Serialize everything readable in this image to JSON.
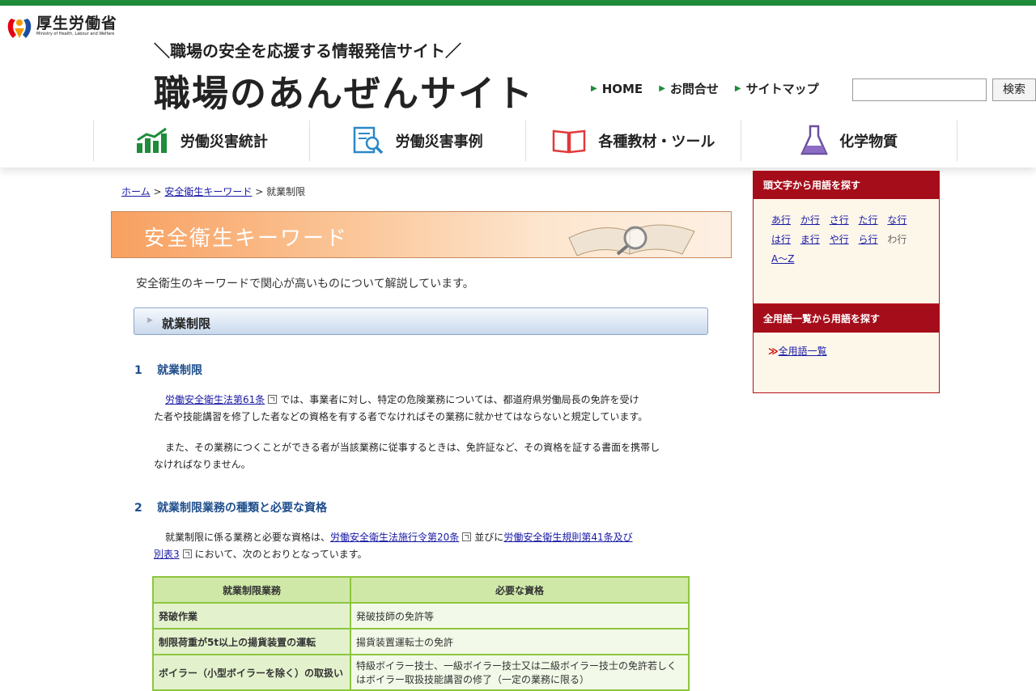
{
  "ministry": {
    "name": "厚生労働省",
    "english": "Ministry of Health, Labour and Welfare"
  },
  "site": {
    "tagline": "＼職場の安全を応援する情報発信サイト／",
    "title": "職場のあんぜんサイト"
  },
  "util_nav": [
    "HOME",
    "お問合せ",
    "サイトマップ"
  ],
  "search": {
    "button": "検索",
    "value": ""
  },
  "global_nav": [
    {
      "label": "労働災害統計",
      "icon": "bar-chart-icon"
    },
    {
      "label": "労働災害事例",
      "icon": "document-search-icon"
    },
    {
      "label": "各種教材・ツール",
      "icon": "book-icon"
    },
    {
      "label": "化学物質",
      "icon": "flask-icon"
    }
  ],
  "breadcrumb": {
    "home": "ホーム",
    "sep1": ">",
    "category": "安全衛生キーワード",
    "sep2": ">",
    "current": "就業制限"
  },
  "banner": {
    "title": "安全衛生キーワード"
  },
  "lead": "安全衛生のキーワードで関心が高いものについて解説しています。",
  "section_heading": "就業制限",
  "sections": [
    {
      "num": "1",
      "title": "就業制限",
      "p1_link": "労働安全衛生法第61条",
      "p1_text_a": "では、事業者に対し、特定の危険業務については、都道府県労働局長の免許を受け",
      "p1_text_b": "た者や技能講習を修了した者などの資格を有する者でなければその業務に就かせてはならないと規定しています。",
      "p2_a": "また、その業務につくことができる者が当該業務に従事するときは、免許証など、その資格を証する書面を携帯し",
      "p2_b": "なければなりません。"
    },
    {
      "num": "2",
      "title": "就業制限業務の種類と必要な資格",
      "p_text_a": "就業制限に係る業務と必要な資格は、",
      "p_link1": "労働安全衛生法施行令第20条",
      "p_text_b": "並びに",
      "p_link2a": "労働安全衛生規則第41条及び",
      "p_link2b": "別表3",
      "p_text_c": "において、次のとおりとなっています。"
    }
  ],
  "table": {
    "headers": [
      "就業制限業務",
      "必要な資格"
    ],
    "rows": [
      {
        "work": "発破作業",
        "qual": "発破技師の免許等"
      },
      {
        "work": "制限荷重が5t以上の揚貨装置の運転",
        "qual": "揚貨装置運転士の免許"
      },
      {
        "work": "ボイラー（小型ボイラーを除く）の取扱い",
        "qual": "特級ボイラー技士、一級ボイラー技士又は二級ボイラー技士の免許若しくはボイラー取扱技能講習の修了（一定の業務に限る）"
      }
    ]
  },
  "sidebar": {
    "initial_heading": "頭文字から用語を探す",
    "kana_row1": [
      "あ行",
      "か行",
      "さ行",
      "た行",
      "な行"
    ],
    "kana_row2": [
      "は行",
      "ま行",
      "や行",
      "ら行"
    ],
    "kana_row2_inactive": "わ行",
    "alpha": "A～Z",
    "all_heading": "全用語一覧から用語を探す",
    "all_link_mark": "≫",
    "all_link": "全用語一覧"
  },
  "colors": {
    "brand_green": "#1e8c3a",
    "sidebar_red": "#a50d1a",
    "heading_blue": "#1f4e8c",
    "table_border": "#8cc63f"
  }
}
